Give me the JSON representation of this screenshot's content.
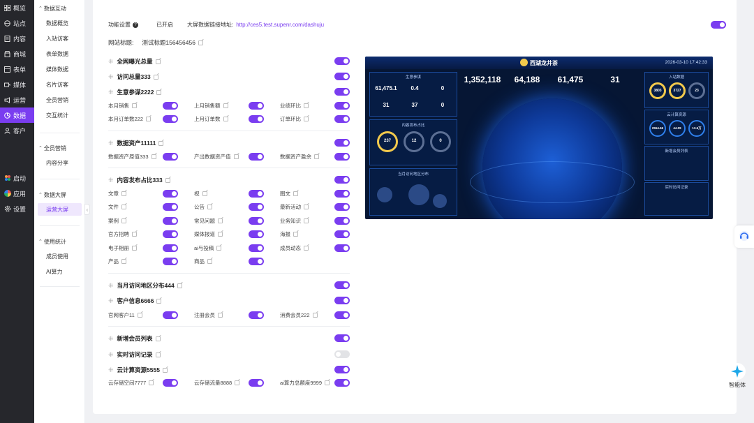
{
  "nav": {
    "items": [
      {
        "label": "概览",
        "icon": "grid-icon"
      },
      {
        "label": "站点",
        "icon": "globe-icon"
      },
      {
        "label": "内容",
        "icon": "document-icon"
      },
      {
        "label": "商城",
        "icon": "shop-icon"
      },
      {
        "label": "表单",
        "icon": "form-icon"
      },
      {
        "label": "媒体",
        "icon": "video-icon"
      },
      {
        "label": "运营",
        "icon": "megaphone-icon"
      },
      {
        "label": "数据",
        "icon": "chart-pie-icon"
      },
      {
        "label": "客户",
        "icon": "user-icon"
      }
    ],
    "bottom": [
      {
        "label": "启动",
        "icon": "launch-icon"
      },
      {
        "label": "应用",
        "icon": "apps-icon"
      },
      {
        "label": "设置",
        "icon": "gear-icon"
      }
    ],
    "active_color": "#7a3df0"
  },
  "submenu": {
    "groups": [
      {
        "title": "数据互动",
        "items": [
          "数据概览",
          "入站访客",
          "表单数据",
          "媒体数据",
          "名片访客",
          "全员营销",
          "交互统计"
        ]
      },
      {
        "title": "全员营销",
        "items": [
          "内容分享"
        ]
      },
      {
        "title": "数据大屏",
        "items": [
          "运营大屏"
        ]
      },
      {
        "title": "使用统计",
        "items": [
          "成员使用",
          "AI算力"
        ]
      }
    ]
  },
  "settings": {
    "feature_label": "功能设置",
    "status": "已开启",
    "link_label": "大屏数据链接地址:",
    "link_url": "http://ces5.test.supenr.com/dashuju",
    "site_title_label": "网站标题:",
    "site_title": "测试标题156456456"
  },
  "sections": {
    "s1": "全网曝光总量",
    "s2": "访问总量333",
    "s3": "生意参谋2222",
    "s3_items": [
      "本月销售",
      "上月销售额",
      "业绩环比",
      "本月订单数222",
      "上月订单数",
      "订单环比"
    ],
    "s4": "数据资产11111",
    "s4_items": [
      "数据资产原值333",
      "产出数据资产值",
      "数据资产盈余"
    ],
    "s5": "内容发布占比333",
    "s5_items": [
      "文章",
      "视",
      "图文",
      "文件",
      "公告",
      "最新活动",
      "案例",
      "常见问题",
      "业务知识",
      "官方招聘",
      "媒体报道",
      "海报",
      "电子相册",
      "ai与投稿",
      "成员动态",
      "产品",
      "商品"
    ],
    "s6": "当月访问地区分布444",
    "s7": "客户信息6666",
    "s7_items": [
      "官网客户11",
      "注册会员",
      "消费会员222"
    ],
    "s8": "新增会员列表",
    "s9": "实时访问记录",
    "s10": "云计算资源5555",
    "s10_items": [
      "云存储空间7777",
      "云存储流量8888",
      "ai算力总额度9999"
    ]
  },
  "preview": {
    "title": "西湖龙井茶",
    "time": "2026-03-10 17:42:33",
    "left_title": "生意参谋",
    "left_nums": [
      "61,475.1",
      "0.4",
      "0",
      "31",
      "37",
      "0"
    ],
    "content_title": "内容发布占比",
    "rings": [
      "237",
      "12",
      "0"
    ],
    "region_title": "当月访问地区分布",
    "big_nums": [
      "1,352,118",
      "64,188",
      "61,475",
      "31"
    ],
    "right_title1": "入站数据",
    "right_rings": [
      "3803",
      "3727",
      "23"
    ],
    "right_title2": "云计算资源",
    "cloud_rings": [
      "2554.66",
      "44.09",
      "13.6万"
    ],
    "right_title3": "新增会员列表",
    "right_title4": "实时访问记录"
  },
  "agent": {
    "label": "智能体"
  }
}
